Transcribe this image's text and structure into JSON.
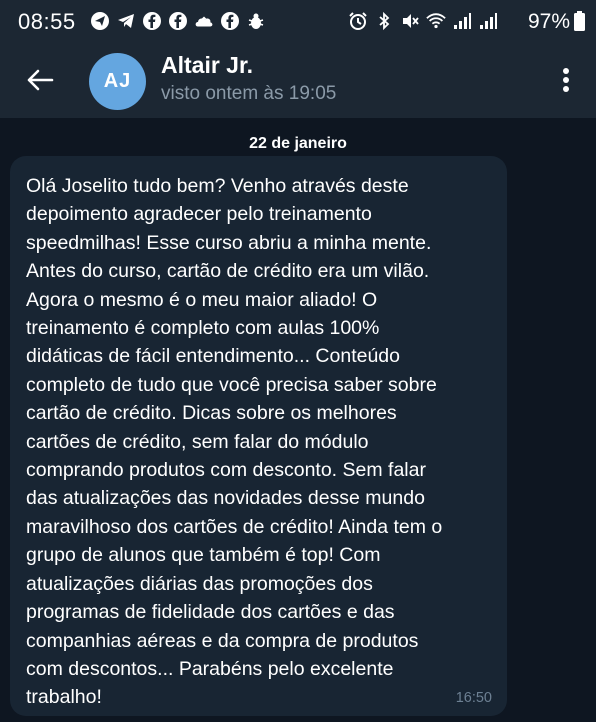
{
  "status_bar": {
    "time": "08:55",
    "battery": "97%",
    "notification_icons": [
      "send-icon",
      "telegram-icon",
      "facebook-icon",
      "facebook-icon",
      "cloud-upload-icon",
      "facebook-icon",
      "bug-icon"
    ],
    "system_icons": [
      "alarm-icon",
      "bluetooth-icon",
      "mute-icon",
      "wifi-icon",
      "signal-icon",
      "signal-icon"
    ]
  },
  "header": {
    "avatar_initials": "AJ",
    "name": "Altair Jr.",
    "status": "visto ontem às 19:05",
    "avatar_color": "#64a6e0"
  },
  "chat": {
    "date": "22 de janeiro",
    "message": {
      "text": "Olá Joselito tudo bem? Venho através deste\ndepoimento agradecer pelo treinamento\nspeedmilhas! Esse curso abriu a minha mente.\nAntes do curso, cartão de crédito era um vilão.\nAgora o mesmo é o meu maior aliado! O\ntreinamento é completo com aulas 100%\ndidáticas de fácil entendimento... Conteúdo\ncompleto de tudo que você precisa saber sobre\ncartão de crédito. Dicas sobre os melhores\ncartões de crédito, sem falar do módulo\ncomprando produtos com desconto. Sem falar\ndas atualizações das novidades desse mundo\nmaravilhoso dos cartões de crédito! Ainda tem o\ngrupo de alunos que também é top! Com\natualizações diárias das promoções dos\nprogramas de fidelidade dos cartões e das\ncompanhias aéreas e da compra de produtos\ncom descontos... Parabéns pelo excelente\ntrabalho!",
      "time": "16:50"
    }
  },
  "colors": {
    "header_bg": "#1c2733",
    "chat_bg": "#0e1621",
    "bubble_bg": "#182533",
    "muted_text": "#8b9aa8"
  }
}
